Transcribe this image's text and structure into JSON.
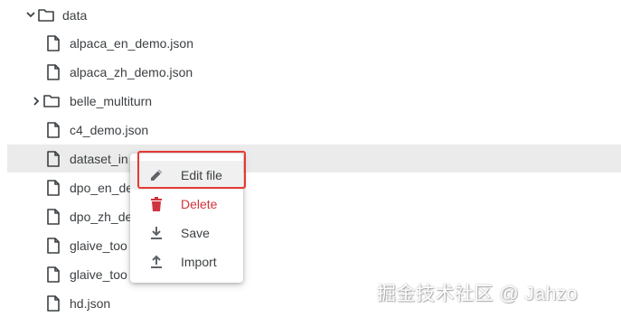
{
  "tree": {
    "folder_data": "data",
    "items": [
      "alpaca_en_demo.json",
      "alpaca_zh_demo.json",
      "belle_multiturn",
      "c4_demo.json",
      "dataset_in",
      "dpo_en_de",
      "dpo_zh_de",
      "glaive_too",
      "glaive_too",
      "hd.json"
    ]
  },
  "context_menu": {
    "edit": "Edit file",
    "delete": "Delete",
    "save": "Save",
    "import": "Import"
  },
  "colors": {
    "delete_accent": "#d0343e",
    "highlight_border": "#e53935",
    "selected_row": "#ebebeb"
  },
  "watermark": "掘金技术社区 @ Jahzo"
}
